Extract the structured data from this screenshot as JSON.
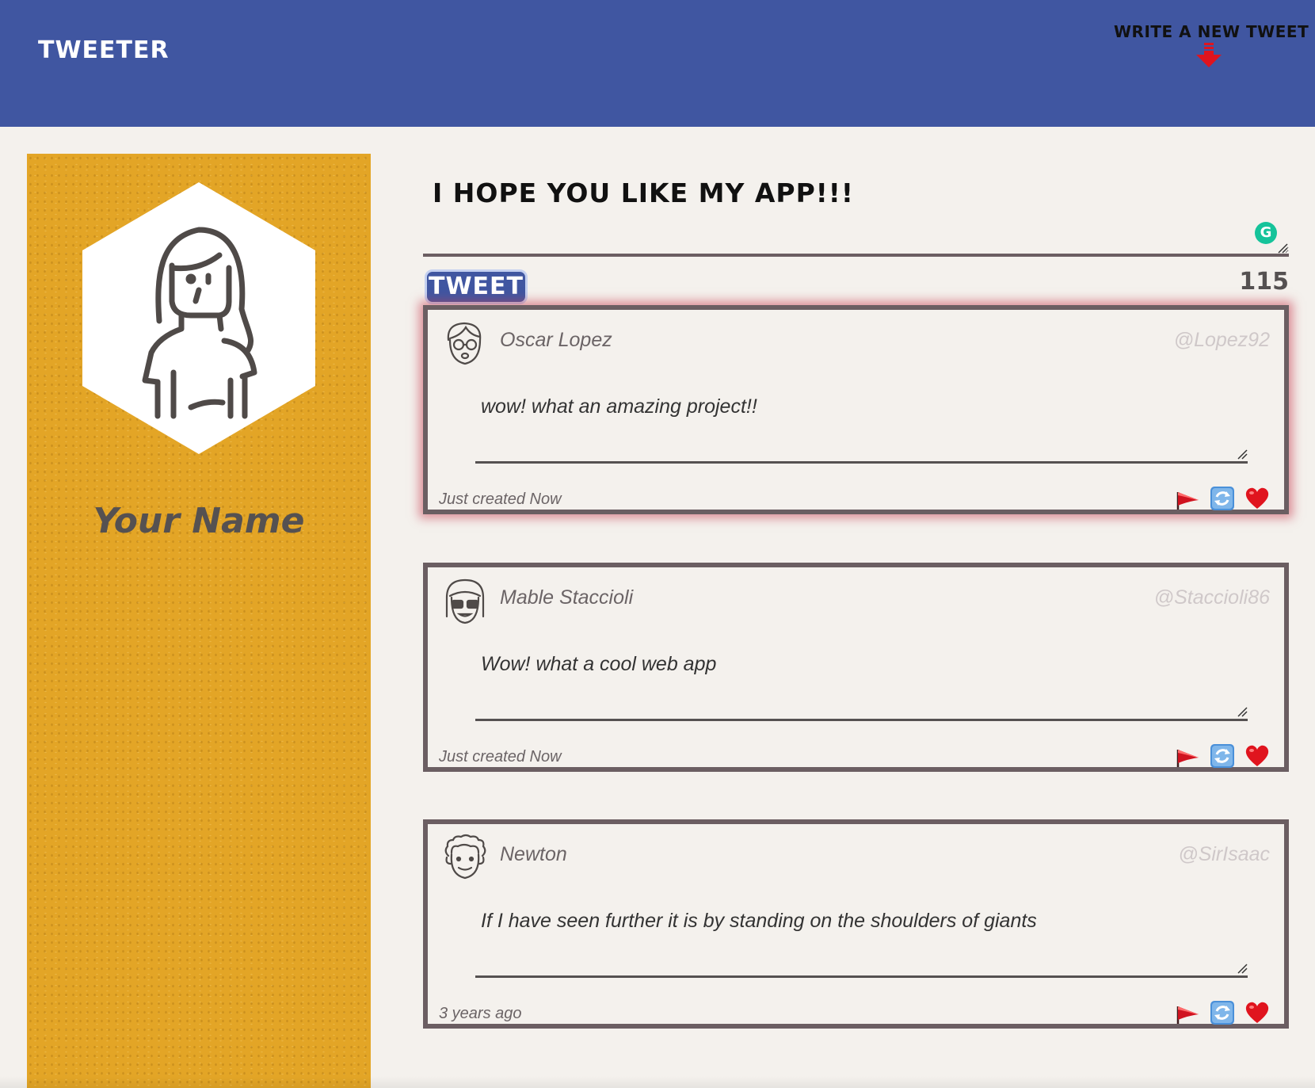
{
  "header": {
    "brand": "TWEETER",
    "write_new": "WRITE A NEW TWEET"
  },
  "profile": {
    "name": "Your Name",
    "avatar_icon": "woman-avatar-icon"
  },
  "compose": {
    "heading": "I HOPE YOU LIKE MY APP!!!",
    "textarea_value": "",
    "button_label": "TWEET",
    "char_counter": "115",
    "grammarly_badge": "G"
  },
  "tweets": [
    {
      "avatar_icon": "glasses-man-avatar-icon",
      "name": "Oscar Lopez",
      "handle": "@Lopez92",
      "content": "wow! what an amazing project!!",
      "timestamp": "Just created Now",
      "hovered": true
    },
    {
      "avatar_icon": "sunglasses-avatar-icon",
      "name": "Mable Staccioli",
      "handle": "@Staccioli86",
      "content": "Wow! what a cool web app",
      "timestamp": "Just created Now",
      "hovered": false
    },
    {
      "avatar_icon": "curly-hair-avatar-icon",
      "name": "Newton",
      "handle": "@SirIsaac",
      "content": "If I have seen further it is by standing on the shoulders of giants",
      "timestamp": "3 years ago",
      "hovered": false
    }
  ],
  "actions": [
    "flag-icon",
    "retweet-icon",
    "heart-icon"
  ],
  "colors": {
    "nav_bg": "#4056a1",
    "profile_bg": "#e3a526",
    "page_bg": "#f4f1ed",
    "tweet_border": "#6b5e62",
    "accent_red": "#e0141e"
  }
}
